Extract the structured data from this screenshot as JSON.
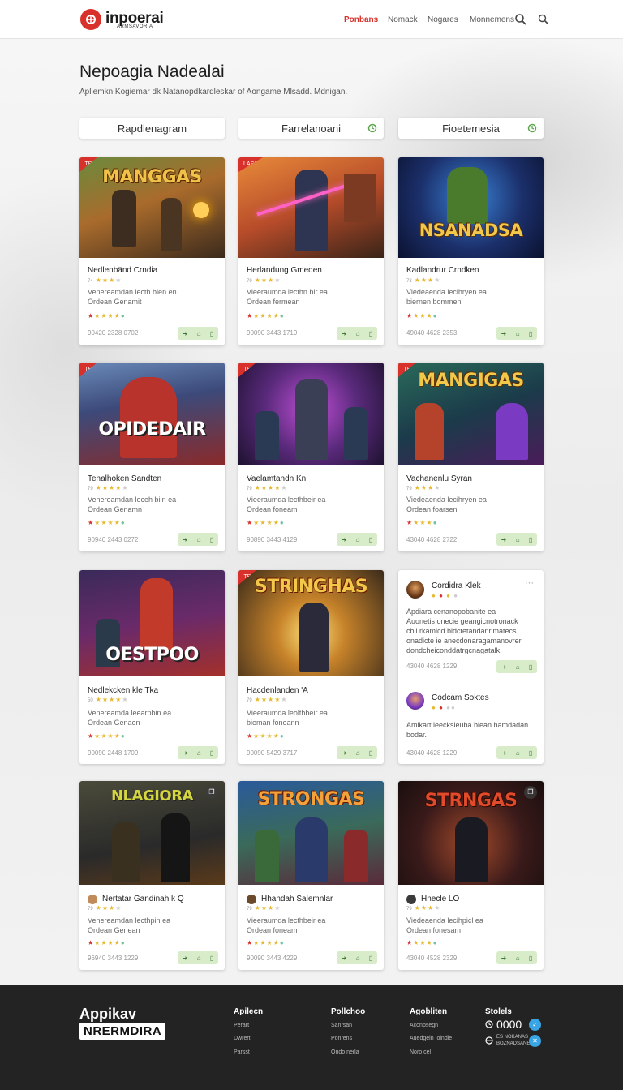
{
  "header": {
    "logo_text": "inpoerai",
    "logo_sub": "ARMSAVORIA",
    "nav": [
      "Ponbans",
      "Nomack",
      "Nogares",
      "Monnemens"
    ]
  },
  "hero": {
    "title": "Nepoagia Nadealai",
    "subtitle": "Apliemkn Kogiemar dk Natanopdkardleskar of Aongame Mlsadd. Mdnigan."
  },
  "filters": [
    "Rapdlenagram",
    "Farrelanoani",
    "Fioetemesia"
  ],
  "cards": [
    {
      "thumb_title": "MANGGAS",
      "badge": "TB",
      "name": "Nedlenbänd Crndia",
      "num": "74",
      "desc": [
        "Venereamdan lecth blen en",
        "Ordean Genamit"
      ],
      "meta": "90420 2328 0702"
    },
    {
      "thumb_title": "",
      "badge": "LASS",
      "name": "Herlandung Gmeden",
      "num": "79",
      "desc": [
        "Vieeraumda lecthn bir ea",
        "Ordean fermean"
      ],
      "meta": "90090 3443 1719"
    },
    {
      "thumb_title": "NSANADSA",
      "badge": "",
      "name": "Kadlandrur Crndken",
      "num": "73",
      "desc": [
        "Viedeaenda lecihryen ea",
        "biernen bommen"
      ],
      "meta": "49040 4628 2353"
    },
    {
      "thumb_title": "OPIDEDAIR",
      "badge": "TB",
      "name": "Tenalhoken Sandten",
      "num": "79",
      "desc": [
        "Venereamdan leceh biin ea",
        "Ordean Genamn"
      ],
      "meta": "90940 2443 0272"
    },
    {
      "thumb_title": "",
      "badge": "TB",
      "name": "Vaelamtandn Kn",
      "num": "79",
      "desc": [
        "Vieeraumda lecthbeir ea",
        "Ordean foneam"
      ],
      "meta": "90890 3443 4129"
    },
    {
      "thumb_title": "MANGIGAS",
      "badge": "TB",
      "name": "Vachanenlu Syran",
      "num": "79",
      "desc": [
        "Viedeaenda lecihryen ea",
        "Ordean foarsen"
      ],
      "meta": "43040 4628 2722"
    },
    {
      "thumb_title": "OESTPOO",
      "badge": "",
      "name": "Nedlekcken kle Tka",
      "num": "50",
      "desc": [
        "Venereamda leearpbin ea",
        "Ordean Genaen"
      ],
      "meta": "90090 2448 1709"
    },
    {
      "thumb_title": "STRINGHAS",
      "badge": "TB",
      "name": "Hacdenlanden 'A",
      "num": "79",
      "desc": [
        "Vieeraumda leolthbeir ea",
        "bieman foneann"
      ],
      "meta": "90090 5429 3717"
    },
    {
      "thumb_title": "NLAGIORA",
      "badge": "",
      "name": "Nertatar Gandinah k Q",
      "num": "79",
      "desc": [
        "Venereamdan lecthpin ea",
        "Ordean Genean"
      ],
      "meta": "96940 3443 1229"
    },
    {
      "thumb_title": "STRONGAS",
      "badge": "",
      "name": "Hhandah Salemnlar",
      "num": "79",
      "desc": [
        "Vieeraumda lecthbeir ea",
        "Ordean foneam"
      ],
      "meta": "90090 3443 4229"
    },
    {
      "thumb_title": "STRNGAS",
      "badge": "",
      "name": "Hnecle LO",
      "num": "79",
      "desc": [
        "Viedeaenda lecihpicl ea",
        "Ordean fonesam"
      ],
      "meta": "43040 4528 2329"
    }
  ],
  "reviews": [
    {
      "name": "Cordidra Klek",
      "text": [
        "Apdiara cenanopobanite ea",
        "Auonetis onecie geangicnotronack",
        "cbil rkamicd bldctetandanrimatecs",
        "onadicte ie anecdonaragamanovrer",
        "dondcheiconddatrgcnagatalk."
      ],
      "meta": "43040 4628 1229"
    },
    {
      "name": "Codcam Soktes",
      "text": [
        "Amikart leecksleuba blean hamdadan",
        "bodar."
      ],
      "meta": "43040 4628 1229"
    }
  ],
  "footer": {
    "brand": "Appikav",
    "brand2": "NRERMDIRA",
    "columns": [
      {
        "heading": "Apilecn",
        "links": [
          "Perart",
          "Dwrert",
          "Parsst"
        ]
      },
      {
        "heading": "Pollchoo",
        "links": [
          "Sanrsan",
          "Ponrens",
          "Ondo nerla"
        ]
      },
      {
        "heading": "Agobliten",
        "links": [
          "Aconpsegn",
          "Auedgein Iolndie",
          "Noro cel"
        ]
      },
      {
        "heading": "Stolels",
        "links": [
          "ES NOKANAS",
          "BOZNADSANE"
        ]
      }
    ],
    "count": "0000"
  }
}
